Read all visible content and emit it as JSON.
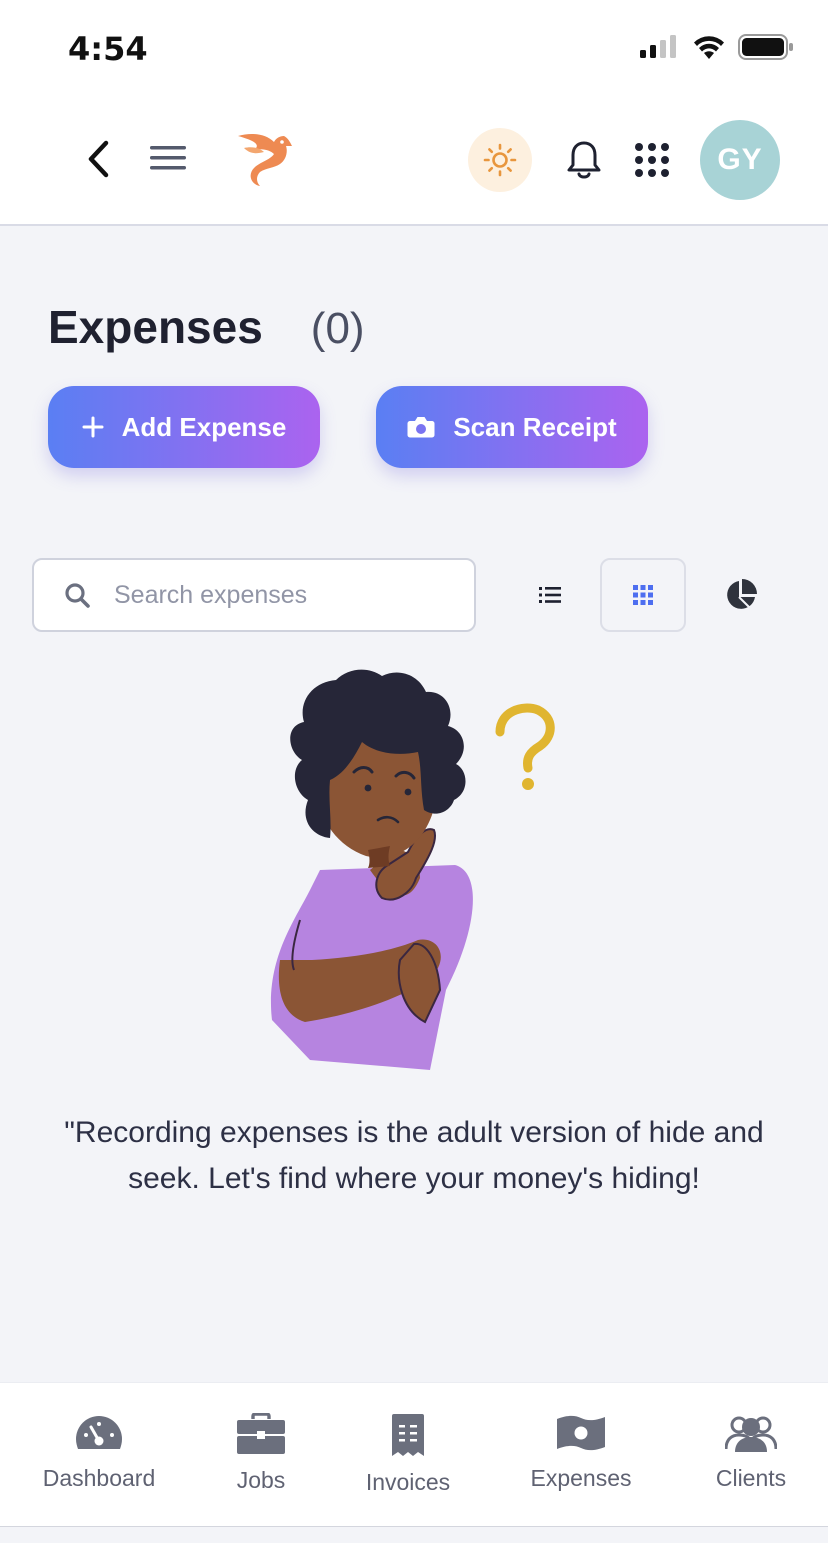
{
  "status_bar": {
    "time": "4:54"
  },
  "header": {
    "avatar_initials": "GY"
  },
  "page": {
    "title": "Expenses",
    "count": "(0)"
  },
  "actions": {
    "add_label": "Add Expense",
    "scan_label": "Scan Receipt"
  },
  "search": {
    "placeholder": "Search expenses",
    "value": ""
  },
  "empty_state": {
    "message": "\"Recording expenses is the adult version of hide and seek. Let's find where your money's hiding!"
  },
  "bottom_nav": {
    "items": [
      {
        "label": "Dashboard",
        "icon": "dashboard-gauge-icon"
      },
      {
        "label": "Jobs",
        "icon": "briefcase-icon"
      },
      {
        "label": "Invoices",
        "icon": "invoice-receipt-icon"
      },
      {
        "label": "Expenses",
        "icon": "money-bill-icon"
      },
      {
        "label": "Clients",
        "icon": "users-icon"
      }
    ]
  },
  "colors": {
    "accent_gradient_start": "#5a7ff3",
    "accent_gradient_end": "#ab63ef",
    "avatar_bg": "#a8d3d6",
    "theme_toggle_bg": "#fdf0df",
    "theme_icon": "#e8963d",
    "question_mark": "#e0b530"
  },
  "view_modes": {
    "selected": "grid"
  }
}
